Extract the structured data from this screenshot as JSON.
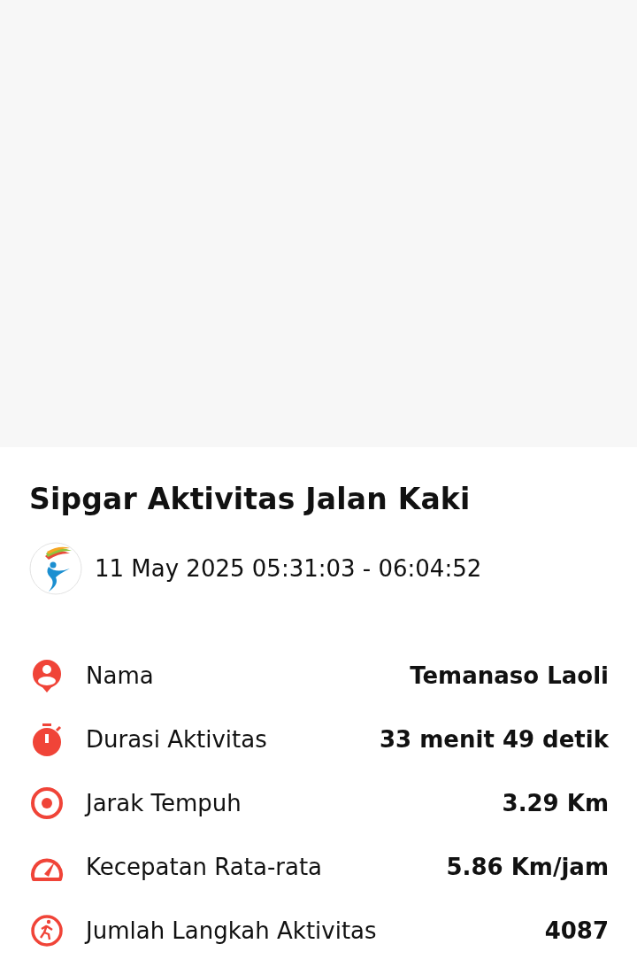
{
  "title": "Sipgar Aktivitas Jalan Kaki",
  "time_range": "11 May 2025 05:31:03 - 06:04:52",
  "stats": [
    {
      "kind": "person",
      "label": "Nama",
      "value": "Temanaso Laoli"
    },
    {
      "kind": "stopwatch",
      "label": "Durasi Aktivitas",
      "value": "33 menit 49 detik"
    },
    {
      "kind": "target",
      "label": "Jarak Tempuh",
      "value": "3.29 Km"
    },
    {
      "kind": "gauge",
      "label": "Kecepatan Rata-rata",
      "value": "5.86 Km/jam"
    },
    {
      "kind": "walker",
      "label": "Jumlah Langkah Aktivitas",
      "value": "4087"
    }
  ]
}
